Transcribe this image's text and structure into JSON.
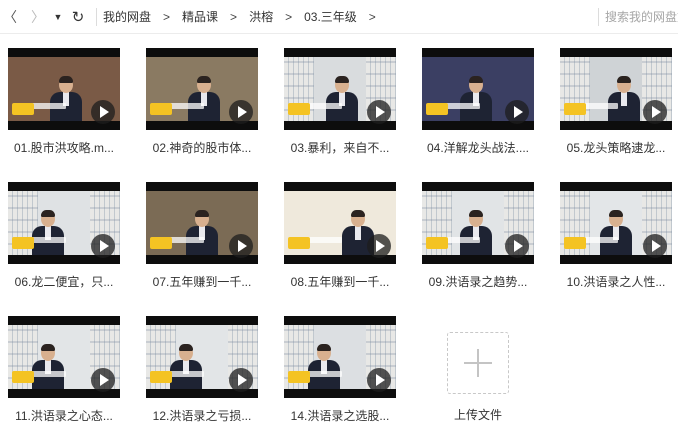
{
  "nav": {
    "back_icon": "chevron-left-icon",
    "forward_icon": "chevron-right-icon",
    "dropdown_icon": "caret-down-icon",
    "refresh_icon": "refresh-icon",
    "back_glyph": "〈",
    "forward_glyph": "〉",
    "dropdown_glyph": "▼",
    "refresh_glyph": "↻"
  },
  "breadcrumb": {
    "separator": ">",
    "items": [
      "我的网盘",
      "精品课",
      "洪榕",
      "03.三年级"
    ]
  },
  "search": {
    "placeholder": "搜索我的网盘文件"
  },
  "files": [
    {
      "name": "01.股市洪攻略.m..."
    },
    {
      "name": "02.神奇的股市体..."
    },
    {
      "name": "03.暴利，来自不..."
    },
    {
      "name": "04.洋解龙头战法...."
    },
    {
      "name": "05.龙头策略逮龙..."
    },
    {
      "name": "06.龙二便宜，只..."
    },
    {
      "name": "07.五年赚到一千..."
    },
    {
      "name": "08.五年赚到一千..."
    },
    {
      "name": "09.洪语录之趋势..."
    },
    {
      "name": "10.洪语录之人性..."
    },
    {
      "name": "11.洪语录之心态..."
    },
    {
      "name": "12.洪语录之亏损..."
    },
    {
      "name": "14.洪语录之选股..."
    }
  ],
  "upload": {
    "label": "上传文件",
    "icon": "plus-icon"
  },
  "colors": {
    "badge": "#f4c323",
    "thumb_bg": "#0d0d0d"
  }
}
